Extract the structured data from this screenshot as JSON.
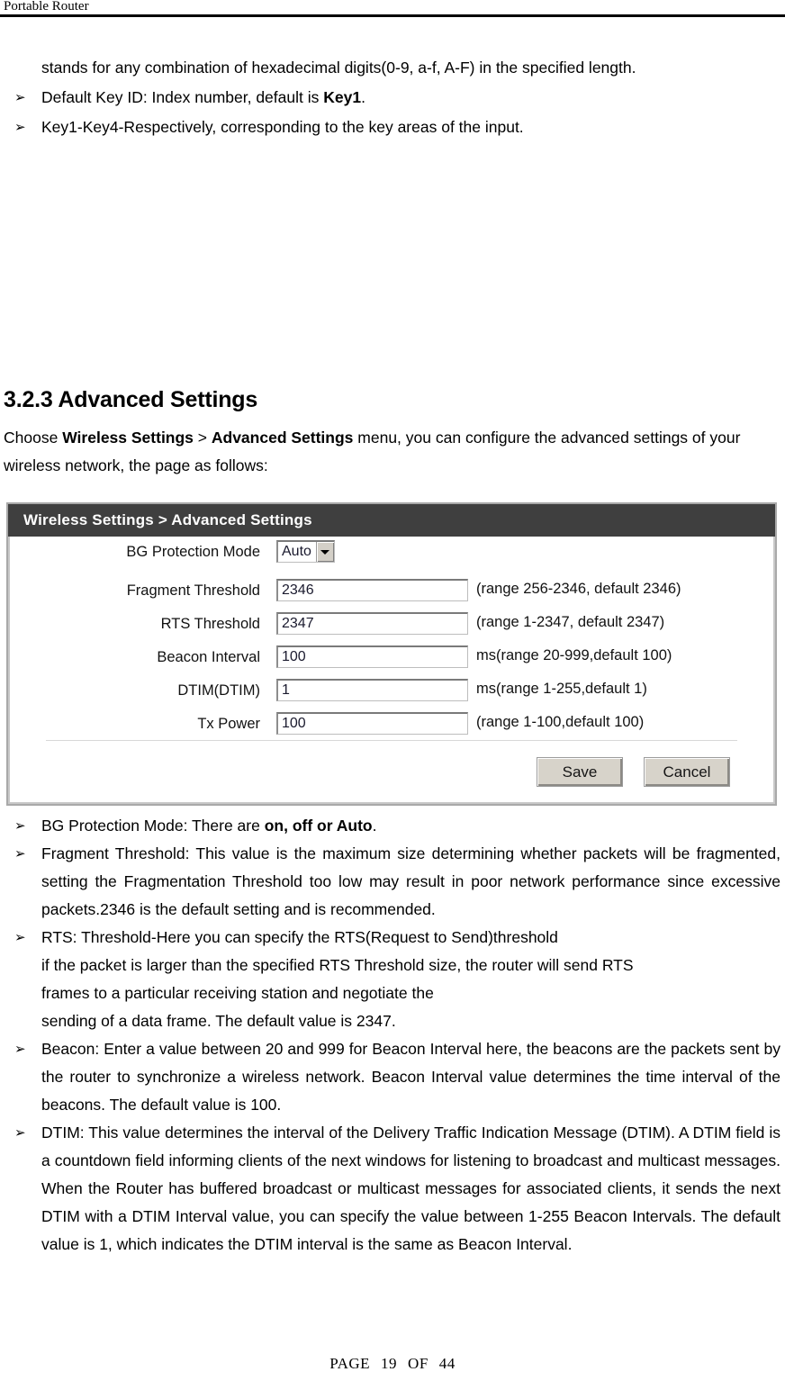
{
  "running_header": {
    "title": "Portable Router"
  },
  "top_text": {
    "continuation_line": "stands for any combination of hexadecimal digits(0-9, a-f, A-F) in the specified length.",
    "bullets": [
      {
        "marker": "➢",
        "before": "Default Key ID: Index number, default is ",
        "bold": "Key1",
        "after": "."
      },
      {
        "marker": "➢",
        "before": "Key1-Key4-Respectively, corresponding to the key areas of the input.",
        "bold": "",
        "after": ""
      }
    ]
  },
  "section": {
    "number_and_title": "3.2.3 Advanced Settings",
    "intro_prefix": "Choose ",
    "intro_bold1": "Wireless Settings",
    "intro_mid": " > ",
    "intro_bold2": "Advanced Settings",
    "intro_suffix": " menu, you can configure the advanced settings of your wireless network, the page as follows:"
  },
  "screenshot": {
    "titlebar": "Wireless Settings > Advanced Settings",
    "rows": [
      {
        "label": "BG Protection Mode",
        "control": "select",
        "value": "Auto",
        "hint": ""
      },
      {
        "label": "Fragment Threshold",
        "control": "text",
        "value": "2346",
        "hint": "(range 256-2346, default 2346)"
      },
      {
        "label": "RTS Threshold",
        "control": "text",
        "value": "2347",
        "hint": "(range 1-2347, default 2347)"
      },
      {
        "label": "Beacon Interval",
        "control": "text",
        "value": "100",
        "hint": "ms(range 20-999,default 100)"
      },
      {
        "label": "DTIM(DTIM)",
        "control": "text",
        "value": "1",
        "hint": "ms(range 1-255,default 1)"
      },
      {
        "label": "Tx Power",
        "control": "text",
        "value": "100",
        "hint": "(range 1-100,default 100)"
      }
    ],
    "buttons": {
      "save": "Save",
      "cancel": "Cancel"
    },
    "colors": {
      "titlebar_bg": "#3f3f3f",
      "titlebar_text": "#ffffff",
      "panel_border": "#a9a9a9",
      "button_face": "#d7d3ca"
    }
  },
  "descriptions": [
    {
      "marker": "➢",
      "before": "BG Protection Mode: There are ",
      "bold": "on, off or Auto",
      "after": "."
    },
    {
      "marker": "➢",
      "before": "Fragment Threshold: This value is the maximum size determining whether packets will be fragmented, setting the Fragmentation Threshold too low may result in poor network performance since excessive packets.2346 is the default setting and is recommended.",
      "bold": "",
      "after": ""
    },
    {
      "marker": "➢",
      "lines": [
        "RTS: Threshold-Here you can specify the RTS(Request to Send)threshold",
        "if the packet is larger than the specified RTS Threshold size, the router will send RTS",
        "frames to a particular receiving station and negotiate the",
        "sending of a data frame. The default value is 2347."
      ]
    },
    {
      "marker": "➢",
      "before": "Beacon: Enter a value between 20 and 999 for Beacon Interval here, the beacons are the packets sent by the router to synchronize a wireless network. Beacon Interval value determines the time interval of the beacons. The default value is 100.",
      "bold": "",
      "after": ""
    },
    {
      "marker": "➢",
      "before": "DTIM: This value determines the interval of the Delivery Traffic Indication Message (DTIM). A DTIM field is a countdown field informing clients of the next windows for listening to broadcast and multicast messages. When the Router has buffered broadcast or multicast messages for associated clients, it sends the next DTIM with a DTIM Interval value, you can specify the value between 1-255 Beacon Intervals. The default value is 1, which indicates the DTIM interval is the same as Beacon Interval.",
      "bold": "",
      "after": ""
    }
  ],
  "footer": {
    "page_word": "PAGE",
    "page_number": "19",
    "of_word": "OF",
    "total_pages": "44"
  }
}
